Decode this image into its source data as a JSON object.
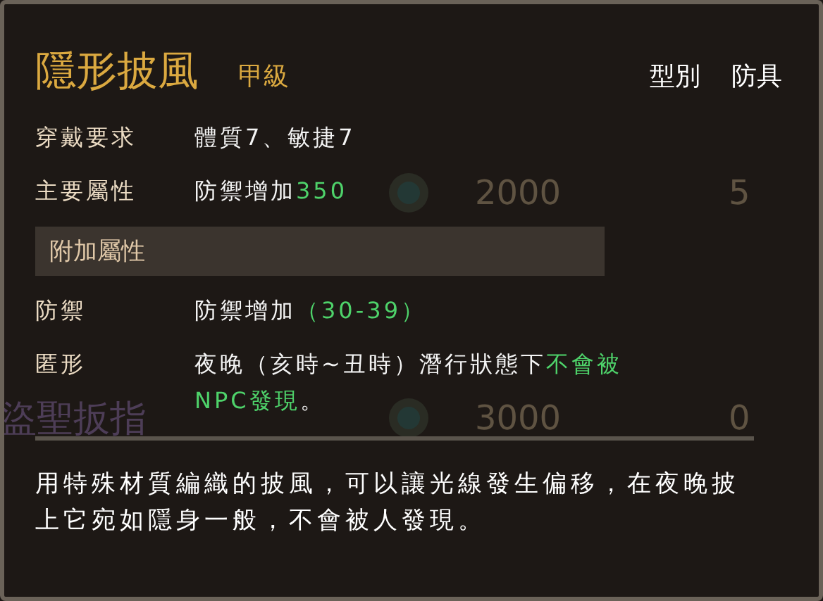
{
  "background_list": [
    {
      "price": "2000",
      "count": "5"
    },
    {
      "name": "盜聖扳指",
      "price": "3000",
      "count": "0"
    }
  ],
  "tooltip": {
    "title": "隱形披風",
    "grade": "甲級",
    "type_label": "型別",
    "type_value": "防具",
    "rows": [
      {
        "label": "穿戴要求",
        "lines": [
          [
            {
              "text": "體質7、敏捷7",
              "highlight": false
            }
          ]
        ]
      },
      {
        "label": "主要屬性",
        "lines": [
          [
            {
              "text": "防禦增加",
              "highlight": false
            },
            {
              "text": "350",
              "highlight": true
            }
          ]
        ]
      }
    ],
    "section": "附加屬性",
    "extra_rows": [
      {
        "label": "防禦",
        "lines": [
          [
            {
              "text": "防禦增加",
              "highlight": false
            },
            {
              "text": "（30-39）",
              "highlight": true
            }
          ]
        ]
      },
      {
        "label": "匿形",
        "lines": [
          [
            {
              "text": "夜晚（亥時~丑時）潛行狀態下",
              "highlight": false
            },
            {
              "text": "不會被",
              "highlight": true
            }
          ],
          [
            {
              "text": "NPC發現",
              "highlight": true
            },
            {
              "text": "。",
              "highlight": false
            }
          ]
        ]
      }
    ],
    "description": "用特殊材質編織的披風，可以讓光線發生偏移，在夜晚披上它宛如隱身一般，不會被人發現。"
  }
}
